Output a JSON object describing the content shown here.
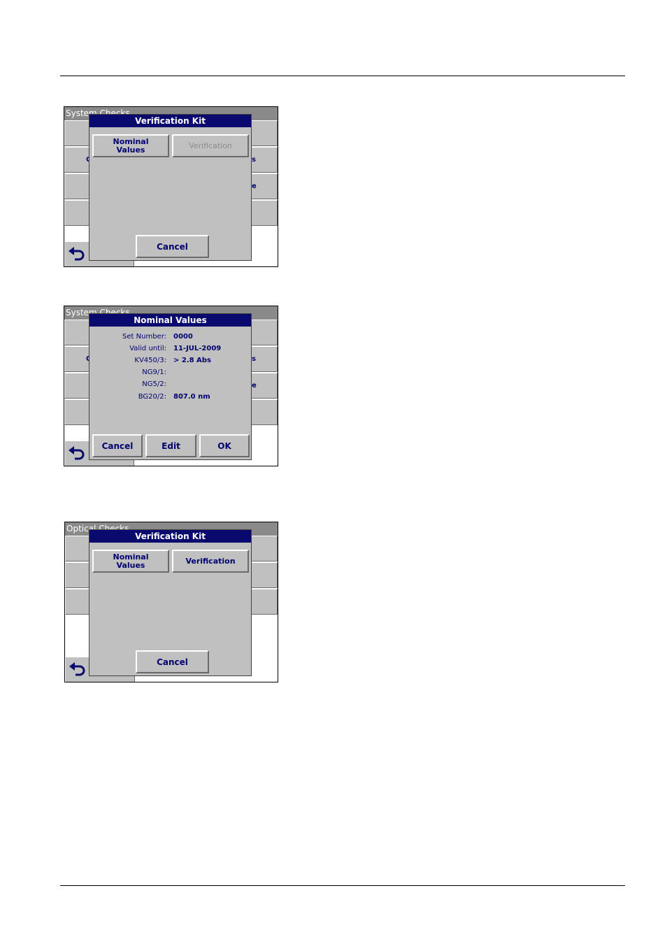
{
  "screen1": {
    "title": "System Checks",
    "left_frags": [
      "",
      "O",
      "",
      ""
    ],
    "right_frags": [
      "",
      "s",
      "e",
      ""
    ],
    "dialog": {
      "title": "Verification Kit",
      "nominal_label": [
        "Nominal",
        "Values"
      ],
      "verification_label": "Verification",
      "cancel_label": "Cancel"
    }
  },
  "screen2": {
    "title": "System Checks",
    "left_frags": [
      "",
      "O",
      "",
      ""
    ],
    "right_frags": [
      "",
      "s",
      "e",
      ""
    ],
    "dialog": {
      "title": "Nominal Values",
      "rows": [
        {
          "label": "Set Number:",
          "value": "0000"
        },
        {
          "label": "Valid until:",
          "value": "11-JUL-2009"
        },
        {
          "label": "KV450/3:",
          "value": "> 2.8 Abs"
        },
        {
          "label": "NG9/1:",
          "value": ""
        },
        {
          "label": "NG5/2:",
          "value": ""
        },
        {
          "label": "BG20/2:",
          "value": "807.0 nm"
        }
      ],
      "cancel_label": "Cancel",
      "edit_label": "Edit",
      "ok_label": "OK"
    }
  },
  "screen3": {
    "title": "Optical Checks",
    "dialog": {
      "title": "Verification Kit",
      "nominal_label": [
        "Nominal",
        "Values"
      ],
      "verification_label": "Verification",
      "cancel_label": "Cancel"
    }
  },
  "icons": {
    "back": "back-arrow-icon"
  },
  "colors": {
    "title_bar": "#0a0a6e",
    "button_face": "#c0c0c0",
    "text": "#00006e"
  }
}
